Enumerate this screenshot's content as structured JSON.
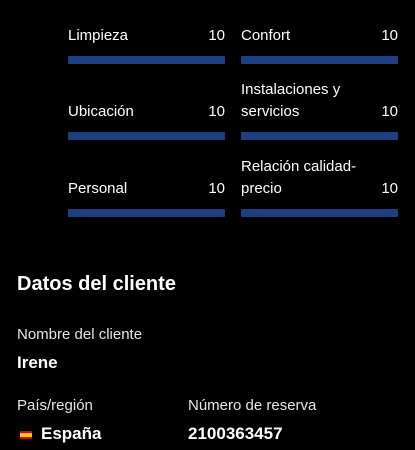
{
  "colors": {
    "background": "#000000",
    "bar_fill": "#1e3f82",
    "bar_track": "#2a2a2a",
    "text": "#ffffff"
  },
  "score_max": 10,
  "scores": [
    {
      "label": "Limpieza",
      "value": "10"
    },
    {
      "label": "Confort",
      "value": "10"
    },
    {
      "label": "Ubicación",
      "value": "10"
    },
    {
      "label": "Instalaciones y servicios",
      "value": "10"
    },
    {
      "label": "Personal",
      "value": "10"
    },
    {
      "label": "Relación calidad-precio",
      "value": "10"
    }
  ],
  "customer": {
    "section_title": "Datos del cliente",
    "name_label": "Nombre del cliente",
    "name_value": "Irene",
    "country_label": "País/región",
    "country_value": "España",
    "country_flag_icon": "spain-flag-icon",
    "booking_label": "Número de reserva",
    "booking_value": "2100363457"
  }
}
